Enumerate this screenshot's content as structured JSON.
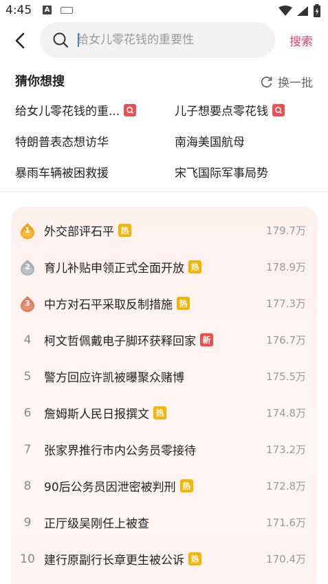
{
  "status_bar": {
    "time": "4:45",
    "a_icon_letter": "A"
  },
  "search": {
    "placeholder": "给女儿零花钱的重要性",
    "button_label": "搜索"
  },
  "guess": {
    "title": "猜你想搜",
    "refresh_label": "换一批",
    "items": [
      {
        "label": "给女儿零花钱的重...",
        "tag": "search"
      },
      {
        "label": "儿子想要点零花钱",
        "tag": "search"
      },
      {
        "label": "特朗普表态想访华",
        "tag": ""
      },
      {
        "label": "南海美国航母",
        "tag": ""
      },
      {
        "label": "暴雨车辆被困救援",
        "tag": ""
      },
      {
        "label": "宋飞国际军事局势",
        "tag": ""
      }
    ]
  },
  "hot_list": [
    {
      "rank": "1",
      "title": "外交部评石平",
      "tag": "热",
      "heat": "179.7万"
    },
    {
      "rank": "2",
      "title": "育儿补贴申领正式全面开放",
      "tag": "热",
      "heat": "178.9万"
    },
    {
      "rank": "3",
      "title": "中方对石平采取反制措施",
      "tag": "热",
      "heat": "177.3万"
    },
    {
      "rank": "4",
      "title": "柯文哲佩戴电子脚环获释回家",
      "tag": "新",
      "heat": "176.7万"
    },
    {
      "rank": "5",
      "title": "警方回应许凯被曝聚众赌博",
      "tag": "",
      "heat": "175.5万"
    },
    {
      "rank": "6",
      "title": "詹姆斯人民日报撰文",
      "tag": "热",
      "heat": "174.8万"
    },
    {
      "rank": "7",
      "title": "张家界推行市内公务员零接待",
      "tag": "",
      "heat": "173.2万"
    },
    {
      "rank": "8",
      "title": "90后公务员因泄密被判刑",
      "tag": "热",
      "heat": "172.8万"
    },
    {
      "rank": "9",
      "title": "正厅级吴刚任上被查",
      "tag": "",
      "heat": "171.6万"
    },
    {
      "rank": "10",
      "title": "建行原副行长章更生被公诉",
      "tag": "热",
      "heat": "170.4万"
    }
  ],
  "colors": {
    "accent": "#e9436f",
    "hot_tag": "#f5b400",
    "new_tag": "#ef4c4c",
    "gold": "#f0a21f",
    "silver": "#a8adb6",
    "bronze": "#e2795a"
  }
}
